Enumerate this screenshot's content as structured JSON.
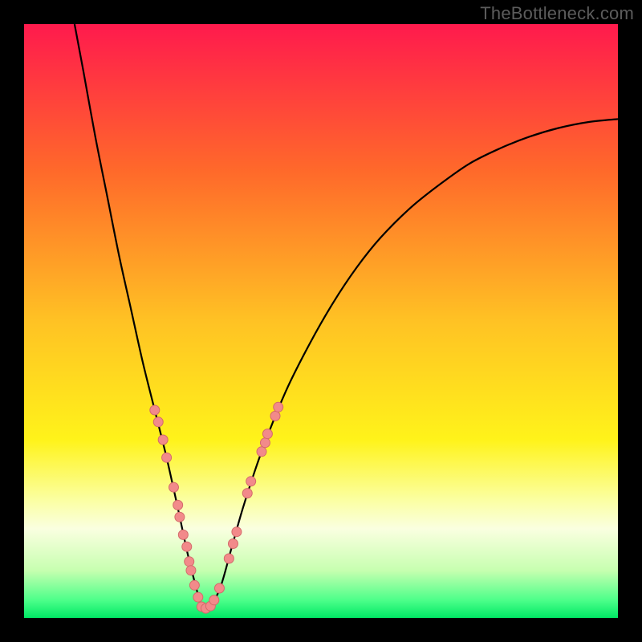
{
  "watermark": "TheBottleneck.com",
  "chart_data": {
    "type": "line",
    "title": "",
    "xlabel": "",
    "ylabel": "",
    "xlim": [
      0,
      100
    ],
    "ylim": [
      0,
      100
    ],
    "grid": false,
    "legend": false,
    "background_gradient": {
      "stops": [
        {
          "pos": 0.0,
          "color": "#ff1a4d"
        },
        {
          "pos": 0.25,
          "color": "#ff6a2a"
        },
        {
          "pos": 0.5,
          "color": "#ffc224"
        },
        {
          "pos": 0.7,
          "color": "#fff31a"
        },
        {
          "pos": 0.8,
          "color": "#fbffa0"
        },
        {
          "pos": 0.85,
          "color": "#faffe0"
        },
        {
          "pos": 0.92,
          "color": "#c7ffb0"
        },
        {
          "pos": 0.97,
          "color": "#4dff8a"
        },
        {
          "pos": 1.0,
          "color": "#00e865"
        }
      ]
    },
    "series": [
      {
        "name": "bottleneck-curve",
        "color": "#000000",
        "x": [
          8.5,
          10,
          12,
          14,
          16,
          18,
          20,
          22,
          24,
          26,
          27.5,
          29,
          30,
          31,
          33,
          35,
          37,
          40,
          44,
          48,
          52,
          56,
          60,
          65,
          70,
          75,
          80,
          85,
          90,
          95,
          100
        ],
        "y": [
          100,
          92,
          81,
          71,
          61,
          52,
          43,
          35,
          27,
          18,
          11,
          5,
          1.5,
          1.5,
          5,
          12,
          19,
          28,
          38,
          46,
          53,
          59,
          64,
          69,
          73,
          76.5,
          79,
          81,
          82.5,
          83.5,
          84
        ]
      }
    ],
    "markers": {
      "color": "#f28a8a",
      "stroke": "#d46a6a",
      "radius_px": 6,
      "points": [
        {
          "x": 22.0,
          "y": 35.0
        },
        {
          "x": 22.6,
          "y": 33.0
        },
        {
          "x": 23.4,
          "y": 30.0
        },
        {
          "x": 24.0,
          "y": 27.0
        },
        {
          "x": 25.2,
          "y": 22.0
        },
        {
          "x": 25.9,
          "y": 19.0
        },
        {
          "x": 26.2,
          "y": 17.0
        },
        {
          "x": 26.8,
          "y": 14.0
        },
        {
          "x": 27.4,
          "y": 12.0
        },
        {
          "x": 27.8,
          "y": 9.5
        },
        {
          "x": 28.1,
          "y": 8.0
        },
        {
          "x": 28.7,
          "y": 5.5
        },
        {
          "x": 29.3,
          "y": 3.5
        },
        {
          "x": 29.9,
          "y": 1.9
        },
        {
          "x": 30.6,
          "y": 1.6
        },
        {
          "x": 31.4,
          "y": 2.0
        },
        {
          "x": 32.0,
          "y": 3.0
        },
        {
          "x": 32.9,
          "y": 5.0
        },
        {
          "x": 34.5,
          "y": 10.0
        },
        {
          "x": 35.2,
          "y": 12.5
        },
        {
          "x": 35.8,
          "y": 14.5
        },
        {
          "x": 37.6,
          "y": 21.0
        },
        {
          "x": 38.2,
          "y": 23.0
        },
        {
          "x": 40.0,
          "y": 28.0
        },
        {
          "x": 40.6,
          "y": 29.5
        },
        {
          "x": 41.0,
          "y": 31.0
        },
        {
          "x": 42.3,
          "y": 34.0
        },
        {
          "x": 42.8,
          "y": 35.5
        }
      ]
    }
  }
}
